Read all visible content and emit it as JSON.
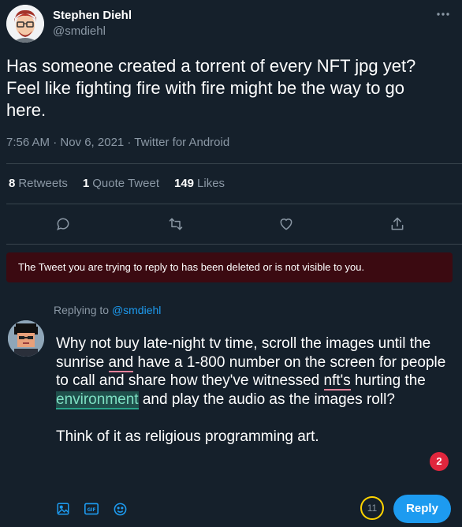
{
  "author": {
    "display_name": "Stephen Diehl",
    "handle": "@smdiehl"
  },
  "tweet": {
    "text_line1": "Has someone created a torrent of every NFT jpg yet?",
    "text_line2": "Feel like fighting fire with fire might be the way to go",
    "text_line3": "here.",
    "timestamp": "7:56 AM · Nov 6, 2021 · Twitter for Android"
  },
  "stats": {
    "retweets_count": "8",
    "retweets_label": "Retweets",
    "quotes_count": "1",
    "quotes_label": "Quote Tweet",
    "likes_count": "149",
    "likes_label": "Likes"
  },
  "notice": {
    "text": "The Tweet you are trying to reply to has been deleted or is not visible to you."
  },
  "reply": {
    "replying_prefix": "Replying to",
    "replying_to": "@smdiehl",
    "seg1": "Why not buy late-night tv time, scroll the images until the sunrise ",
    "seg2": "and",
    "seg3": " have a 1-800 number on the screen for people to call and share how they've witnessed ",
    "seg4": "nft's",
    "seg5": " hurting the ",
    "seg6": "environment",
    "seg7": " and play the audio as the images roll?",
    "paragraph2": "Think of it as religious programming art.",
    "grammar_count": "2",
    "remaining_chars": "11",
    "button_label": "Reply"
  },
  "colors": {
    "background": "#15202b",
    "accent": "#1d9bf0",
    "notice_bg": "#3b0a11",
    "muted": "#8b98a5",
    "counter_ring": "#ffd400"
  },
  "icons": [
    "more-icon",
    "comment-icon",
    "retweet-icon",
    "like-icon",
    "share-icon",
    "image-icon",
    "gif-icon",
    "emoji-icon"
  ]
}
